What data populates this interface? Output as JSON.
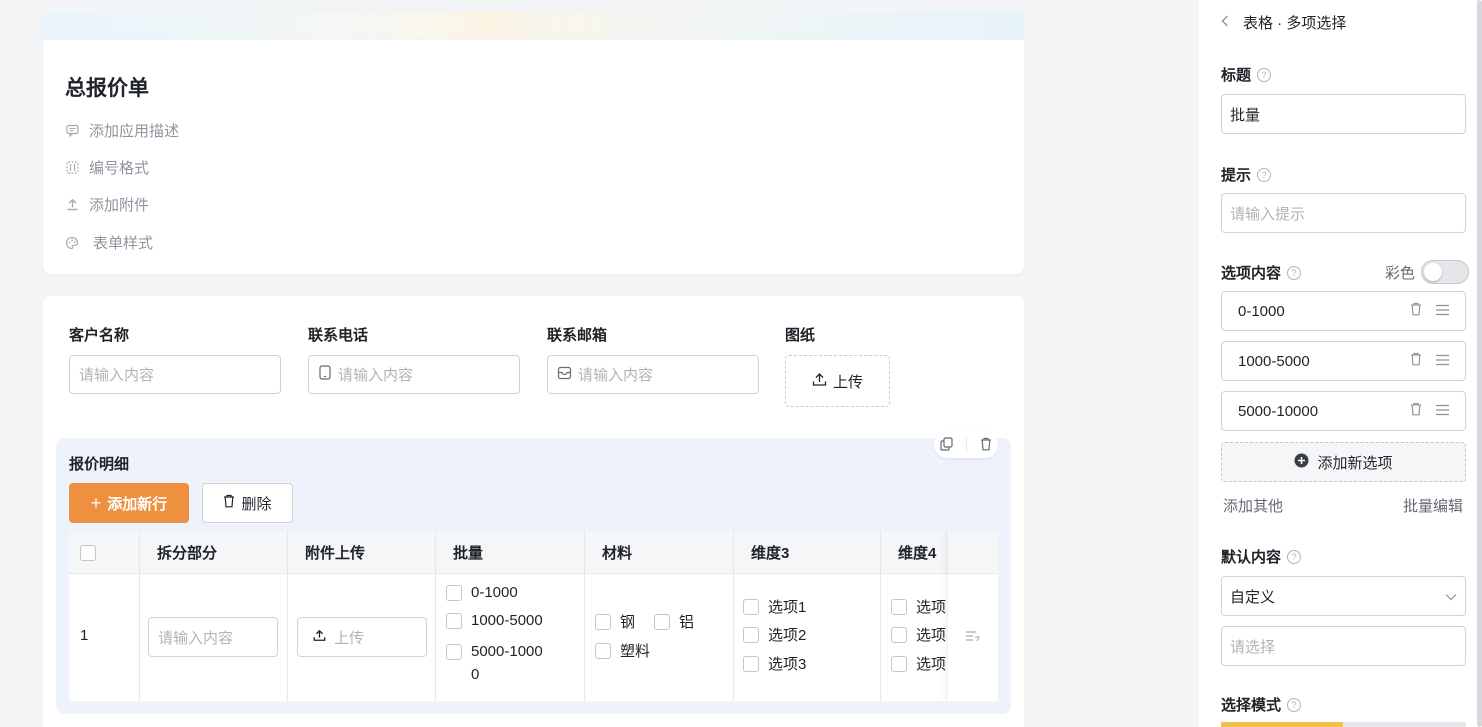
{
  "form": {
    "title": "总报价单",
    "meta": {
      "add_description": "添加应用描述",
      "number_format": "编号格式",
      "add_attachment": "添加附件",
      "form_style": "表单样式"
    }
  },
  "fields": {
    "customer": {
      "label": "客户名称",
      "placeholder": "请输入内容"
    },
    "phone": {
      "label": "联系电话",
      "placeholder": "请输入内容"
    },
    "email": {
      "label": "联系邮箱",
      "placeholder": "请输入内容"
    },
    "drawing": {
      "label": "图纸",
      "upload": "上传"
    }
  },
  "subtable": {
    "title": "报价明细",
    "add_row": "添加新行",
    "delete": "删除",
    "columns": [
      "拆分部分",
      "附件上传",
      "批量",
      "材料",
      "维度3",
      "维度4"
    ],
    "row": {
      "index": "1",
      "split_placeholder": "请输入内容",
      "upload": "上传",
      "batch_options": [
        "0-1000",
        "1000-5000",
        "5000-1000",
        "0"
      ],
      "material_options": [
        "钢",
        "铝",
        "塑料"
      ],
      "dim3_options": [
        "选项1",
        "选项2",
        "选项3"
      ],
      "dim4_options": [
        "选项",
        "选项",
        "选项"
      ]
    }
  },
  "panel": {
    "breadcrumb": "表格 · 多项选择",
    "title_label": "标题",
    "title_value": "批量",
    "hint_label": "提示",
    "hint_placeholder": "请输入提示",
    "options_label": "选项内容",
    "color_label": "彩色",
    "color_enabled": false,
    "options": [
      "0-1000",
      "1000-5000",
      "5000-10000"
    ],
    "add_option": "添加新选项",
    "add_other": "添加其他",
    "batch_edit": "批量编辑",
    "default_label": "默认内容",
    "default_value": "自定义",
    "default_placeholder": "请选择",
    "mode_label": "选择模式"
  },
  "colors": {
    "accent": "#ef8f40",
    "mode_bar": "#f0c24b"
  }
}
